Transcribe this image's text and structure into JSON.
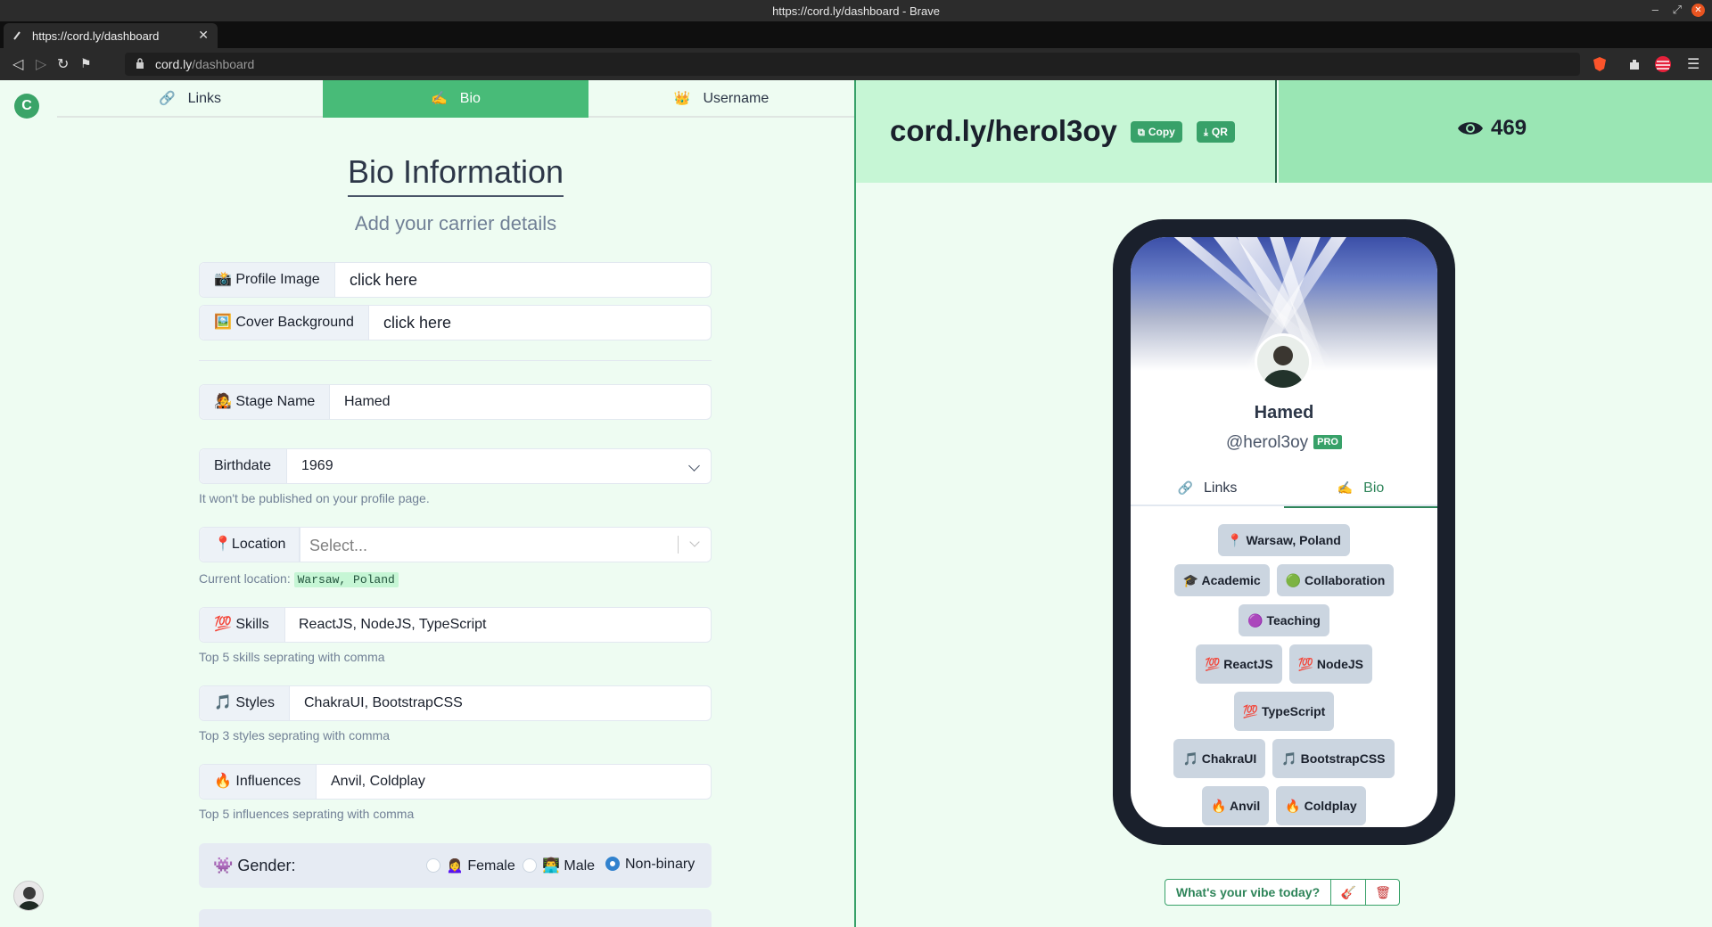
{
  "browser": {
    "window_title": "https://cord.ly/dashboard - Brave",
    "tab_title": "https://cord.ly/dashboard",
    "url_host": "cord.ly",
    "url_path": "/dashboard"
  },
  "app": {
    "brand_letter": "C",
    "tabs": [
      {
        "icon": "🔗",
        "label": "Links"
      },
      {
        "icon": "✍️",
        "label": "Bio"
      },
      {
        "icon": "👑",
        "label": "Username"
      }
    ],
    "active_tab": "Bio"
  },
  "bio_form": {
    "title": "Bio Information",
    "subtitle": "Add your carrier details",
    "profile_image": {
      "label": "📸 Profile Image",
      "value": "click here"
    },
    "cover_background": {
      "label": "🖼️ Cover Background",
      "value": "click here"
    },
    "stage_name": {
      "label": "🧑‍🎤 Stage Name",
      "value": "Hamed"
    },
    "birthdate": {
      "label": "Birthdate",
      "value": "1969",
      "help": "It won't be published on your profile page."
    },
    "location": {
      "label": "📍Location",
      "placeholder": "Select...",
      "help_prefix": "Current location:",
      "current": "Warsaw, Poland"
    },
    "skills": {
      "label": "💯 Skills",
      "value": "ReactJS, NodeJS, TypeScript",
      "help": "Top 5 skills seprating with comma"
    },
    "styles": {
      "label": "🎵 Styles",
      "value": "ChakraUI, BootstrapCSS",
      "help": "Top 3 styles seprating with comma"
    },
    "influences": {
      "label": "🔥 Influences",
      "value": "Anvil, Coldplay",
      "help": "Top 5 influences seprating with comma"
    },
    "gender": {
      "label": "👾 Gender:",
      "options": [
        {
          "label": "🙍‍♀️ Female",
          "checked": false
        },
        {
          "label": "👨‍💻 Male",
          "checked": false
        },
        {
          "label": "Non-binary",
          "checked": true
        }
      ]
    }
  },
  "preview": {
    "profile_url": "cord.ly/herol3oy",
    "copy_label": "Copy",
    "qr_label": "QR",
    "views": "469",
    "name": "Hamed",
    "handle": "@herol3oy",
    "badge": "PRO",
    "tabs": [
      {
        "icon": "🔗",
        "label": "Links"
      },
      {
        "icon": "✍️",
        "label": "Bio"
      }
    ],
    "tags": {
      "location": "📍 Warsaw, Poland",
      "goals": [
        "🎓 Academic",
        "🟢 Collaboration",
        "🟣 Teaching"
      ],
      "skills": [
        "💯 ReactJS",
        "💯 NodeJS",
        "💯 TypeScript"
      ],
      "styles": [
        "🎵 ChakraUI",
        "🎵 BootstrapCSS"
      ],
      "influences": [
        "🔥 Anvil",
        "🔥 Coldplay"
      ]
    },
    "vibe_prompt": "What's your vibe today?"
  },
  "colors": {
    "accent": "#48bb78",
    "page_bg": "#eefcf2",
    "link_header_bg": "#c6f6d5",
    "views_header_bg": "#9ae6b4",
    "phone_frame": "#1a202c"
  }
}
